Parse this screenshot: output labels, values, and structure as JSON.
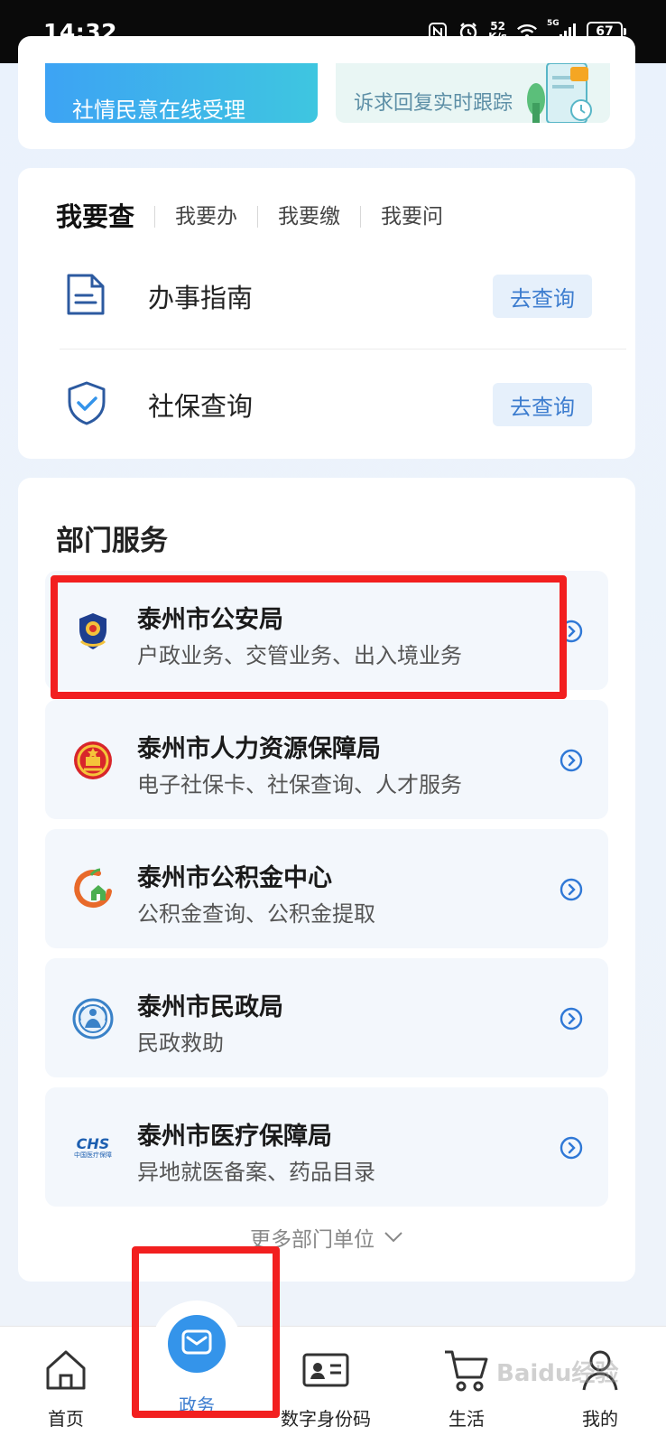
{
  "status_bar": {
    "time": "14:32",
    "speed_value": "52",
    "speed_unit": "K/s",
    "network": "5G",
    "battery": "67"
  },
  "banner": {
    "left_text": "社情民意在线受理",
    "right_text": "诉求回复实时跟踪"
  },
  "query": {
    "tabs": [
      {
        "label": "我要查"
      },
      {
        "label": "我要办"
      },
      {
        "label": "我要缴"
      },
      {
        "label": "我要问"
      }
    ],
    "rows": [
      {
        "label": "办事指南",
        "button": "去查询",
        "icon": "document-icon"
      },
      {
        "label": "社保查询",
        "button": "去查询",
        "icon": "shield-check-icon"
      }
    ]
  },
  "departments": {
    "title": "部门服务",
    "items": [
      {
        "name": "泰州市公安局",
        "desc": "户政业务、交管业务、出入境业务",
        "logo": "police-badge-icon"
      },
      {
        "name": "泰州市人力资源保障局",
        "desc": "电子社保卡、社保查询、人才服务",
        "logo": "national-emblem-icon"
      },
      {
        "name": "泰州市公积金中心",
        "desc": "公积金查询、公积金提取",
        "logo": "housing-fund-icon"
      },
      {
        "name": "泰州市民政局",
        "desc": "民政救助",
        "logo": "civil-affairs-icon"
      },
      {
        "name": "泰州市医疗保障局",
        "desc": "异地就医备案、药品目录",
        "logo": "chs-logo-icon",
        "logo_text": "CHS",
        "logo_subtext": "中国医疗保障"
      }
    ],
    "more_label": "更多部门单位"
  },
  "bottom_nav": {
    "items": [
      {
        "label": "首页",
        "icon": "home-icon"
      },
      {
        "label": "政务",
        "icon": "mail-icon"
      },
      {
        "label": "数字身份码",
        "icon": "id-card-icon"
      },
      {
        "label": "生活",
        "icon": "cart-icon"
      },
      {
        "label": "我的",
        "icon": "person-icon"
      }
    ]
  },
  "watermark": "Baidu经验",
  "colors": {
    "accent": "#3494ea",
    "highlight": "#f21f1f",
    "button_bg": "#e6f0fb",
    "button_text": "#3d7dcf"
  }
}
